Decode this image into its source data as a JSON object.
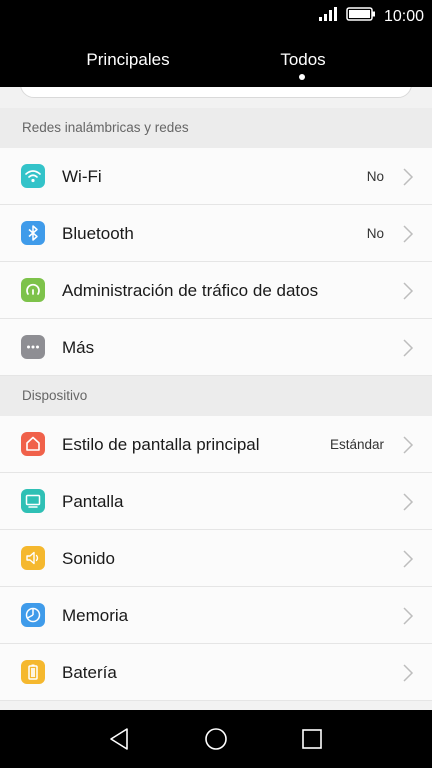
{
  "status_bar": {
    "time": "10:00"
  },
  "tabs": [
    {
      "label": "Principales",
      "active": false
    },
    {
      "label": "Todos",
      "active": true
    }
  ],
  "sections": [
    {
      "header": "Redes inalámbricas y redes",
      "items": [
        {
          "label": "Wi-Fi",
          "value": "No",
          "icon": "wifi-icon",
          "color": "#33c3c9"
        },
        {
          "label": "Bluetooth",
          "value": "No",
          "icon": "bluetooth-icon",
          "color": "#3f9bea"
        },
        {
          "label": "Administración de tráfico de datos",
          "value": "",
          "icon": "data-traffic-icon",
          "color": "#7dc24a"
        },
        {
          "label": "Más",
          "value": "",
          "icon": "more-icon",
          "color": "#8e8e93"
        }
      ]
    },
    {
      "header": "Dispositivo",
      "items": [
        {
          "label": "Estilo de pantalla principal",
          "value": "Estándar",
          "icon": "home-icon",
          "color": "#f0614a"
        },
        {
          "label": "Pantalla",
          "value": "",
          "icon": "display-icon",
          "color": "#2fc0b5"
        },
        {
          "label": "Sonido",
          "value": "",
          "icon": "sound-icon",
          "color": "#f5b82e"
        },
        {
          "label": "Memoria",
          "value": "",
          "icon": "memory-icon",
          "color": "#3f9bea"
        },
        {
          "label": "Batería",
          "value": "",
          "icon": "battery-icon",
          "color": "#f5b82e"
        }
      ]
    }
  ]
}
